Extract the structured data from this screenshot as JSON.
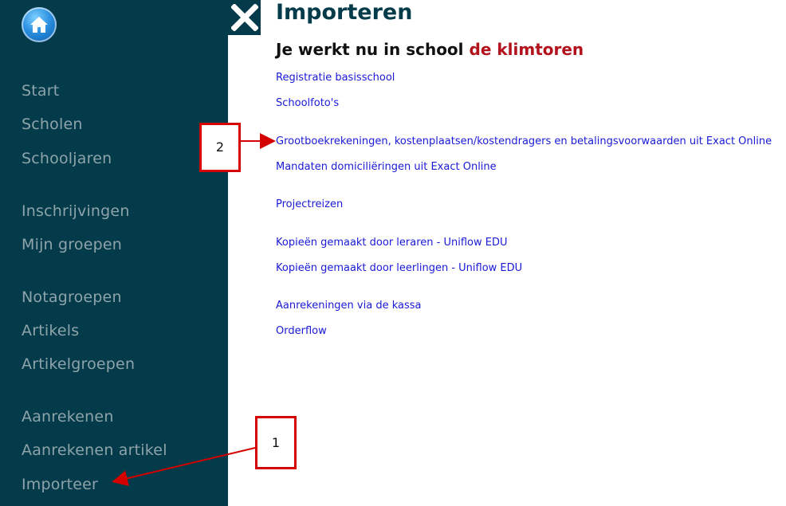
{
  "sidebar": {
    "home_icon": "home-icon",
    "items": [
      {
        "label": "Start"
      },
      {
        "label": "Scholen"
      },
      {
        "label": "Schooljaren"
      },
      {
        "label": "Inschrijvingen"
      },
      {
        "label": "Mijn groepen"
      },
      {
        "label": "Notagroepen"
      },
      {
        "label": "Artikels"
      },
      {
        "label": "Artikelgroepen"
      },
      {
        "label": "Aanrekenen"
      },
      {
        "label": "Aanrekenen artikel"
      },
      {
        "label": "Importeer"
      }
    ]
  },
  "close_icon": "close-icon",
  "main": {
    "title": "Importeren",
    "school_prefix": "Je werkt nu in school",
    "school_name": "de klimtoren",
    "links": [
      {
        "label": "Registratie basisschool"
      },
      {
        "label": "Schoolfoto's"
      },
      {
        "label": "Grootboekrekeningen, kostenplaatsen/kostendragers en betalingsvoorwaarden uit Exact Online"
      },
      {
        "label": "Mandaten domiciliëringen uit Exact Online"
      },
      {
        "label": "Projectreizen"
      },
      {
        "label": "Kopieën gemaakt door leraren - Uniflow EDU"
      },
      {
        "label": "Kopieën gemaakt door leerlingen - Uniflow EDU"
      },
      {
        "label": "Aanrekeningen via de kassa"
      },
      {
        "label": "Orderflow"
      }
    ]
  },
  "annotations": {
    "callout_1": "1",
    "callout_2": "2",
    "color": "#d40000"
  },
  "colors": {
    "sidebar_bg": "#033b4a",
    "school_name": "#b3121c",
    "link": "#1a1ad6"
  }
}
